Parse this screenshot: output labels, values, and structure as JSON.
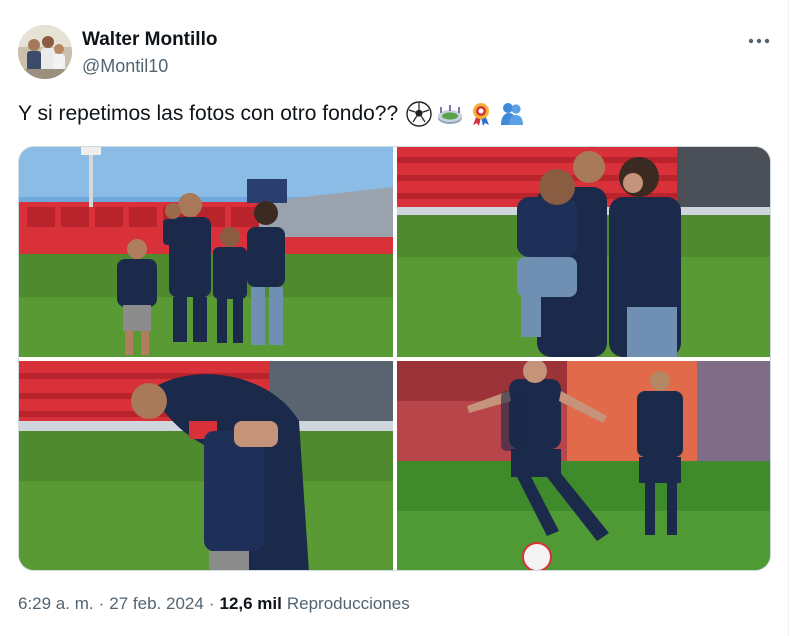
{
  "author": {
    "name": "Walter Montillo",
    "handle": "@Montil10",
    "avatar_icon": "profile-photo"
  },
  "tweet": {
    "text": "Y si repetimos las fotos con otro fondo??",
    "emojis": [
      "soccer-ball-emoji",
      "stadium-emoji",
      "rosette-emoji",
      "people-hugging-emoji"
    ]
  },
  "media": {
    "photo_count": 4,
    "photos": [
      {
        "description_icon": "family-on-pitch-photo"
      },
      {
        "description_icon": "child-hug-photo"
      },
      {
        "description_icon": "embrace-photo"
      },
      {
        "description_icon": "match-action-photo"
      }
    ]
  },
  "meta": {
    "time": "6:29 a. m.",
    "separator": "·",
    "date": "27 feb. 2024",
    "views_count": "12,6 mil",
    "views_label": "Reproducciones"
  },
  "colors": {
    "secondary_text": "#536471",
    "primary_text": "#0f1419",
    "border": "#cfd9de",
    "kit_navy": "#1b2a4a",
    "stadium_red": "#d8313a",
    "pitch_green": "#4f8a2e"
  }
}
